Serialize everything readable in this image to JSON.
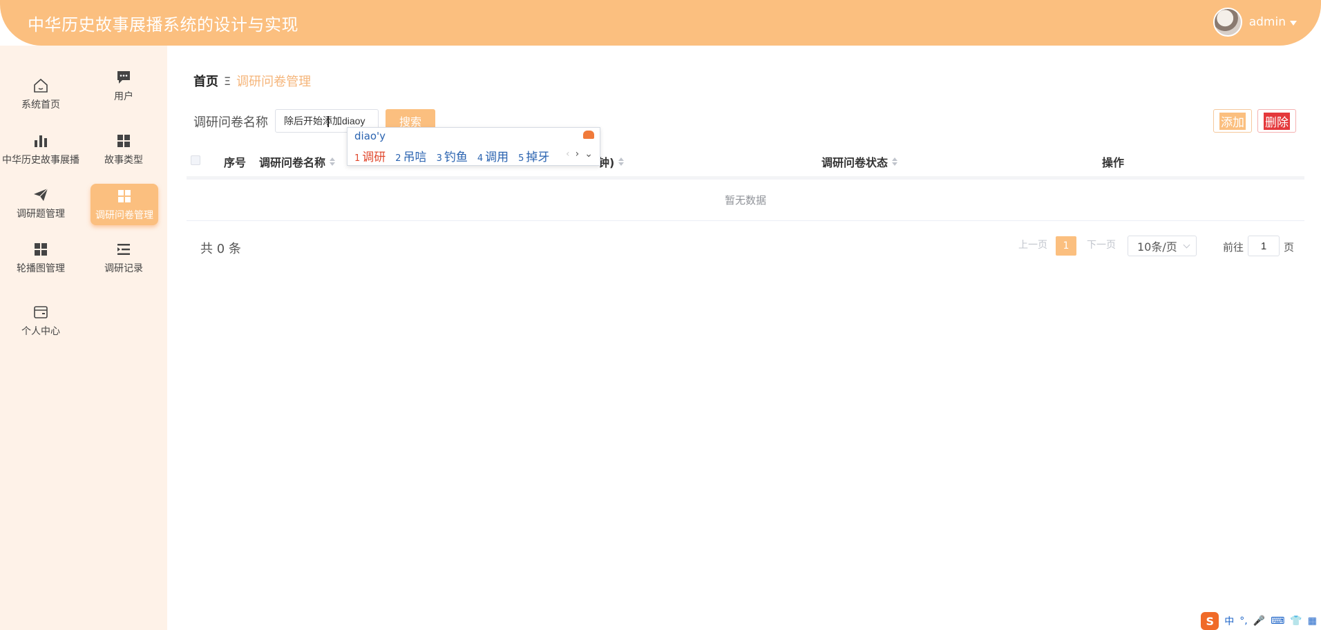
{
  "header": {
    "title": "中华历史故事展播系统的设计与实现",
    "username": "admin"
  },
  "sidebar": {
    "items": [
      {
        "label": "系统首页",
        "icon": "home-icon"
      },
      {
        "label": "用户",
        "icon": "chat-icon"
      },
      {
        "label": "中华历史故事展播",
        "icon": "bar-chart-icon"
      },
      {
        "label": "故事类型",
        "icon": "grid-icon"
      },
      {
        "label": "调研题管理",
        "icon": "paper-plane-icon"
      },
      {
        "label": "调研问卷管理",
        "icon": "grid-icon",
        "active": true
      },
      {
        "label": "轮播图管理",
        "icon": "grid-icon"
      },
      {
        "label": "调研记录",
        "icon": "list-indent-icon"
      },
      {
        "label": "个人中心",
        "icon": "wallet-icon"
      }
    ]
  },
  "breadcrumb": {
    "home": "首页",
    "separator": "Ξ",
    "current": "调研问卷管理"
  },
  "search": {
    "label": "调研问卷名称",
    "value": "除后开始添加diaoy",
    "button": "搜索"
  },
  "actions": {
    "add": "添加",
    "delete": "删除"
  },
  "table": {
    "columns": [
      "序号",
      "调研问卷名称",
      "钟)",
      "调研问卷状态",
      "操作"
    ],
    "empty_text": "暂无数据"
  },
  "pagination": {
    "total": "共 0 条",
    "prev": "上一页",
    "current_page": "1",
    "next": "下一页",
    "page_size": "10条/页",
    "goto_label": "前往",
    "goto_value": "1",
    "goto_suffix": "页"
  },
  "ime": {
    "composition": "diao'y",
    "candidates": [
      {
        "num": "1",
        "text": "调研"
      },
      {
        "num": "2",
        "text": "吊唁"
      },
      {
        "num": "3",
        "text": "钓鱼"
      },
      {
        "num": "4",
        "text": "调用"
      },
      {
        "num": "5",
        "text": "掉牙"
      }
    ]
  },
  "tray": {
    "ime_mode": "中",
    "punct": "°,"
  },
  "colors": {
    "accent": "#fbbf7f",
    "sidebar_bg": "#fef2e8",
    "delete": "#e4393c"
  }
}
